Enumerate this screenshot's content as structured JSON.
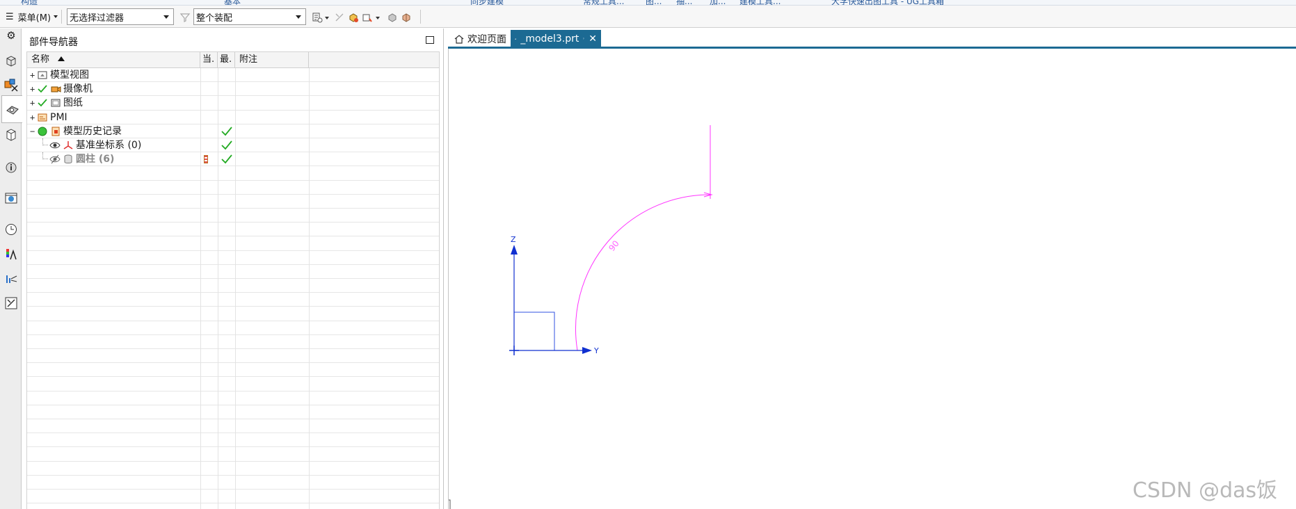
{
  "ribbon": {
    "labels": [
      "构造",
      "基本",
      "同步建模",
      "常规工具...",
      "图...",
      "抽...",
      "加...",
      "建模工具...",
      "大学快速出图工具 - UG工具箱"
    ]
  },
  "toolbar": {
    "menu_label": "菜单(M)",
    "filter_value": "无选择过滤器",
    "scope_value": "整个装配"
  },
  "navigator": {
    "title": "部件导航器",
    "columns": [
      "名称",
      "当.",
      "最.",
      "附注"
    ],
    "rows": [
      {
        "label": "模型视图",
        "expander": "+",
        "check": false,
        "up_to_date": false
      },
      {
        "label": "摄像机",
        "expander": "+",
        "check": true,
        "up_to_date": false
      },
      {
        "label": "图纸",
        "expander": "+",
        "check": true,
        "up_to_date": false
      },
      {
        "label": "PMI",
        "expander": "+",
        "check": false,
        "up_to_date": false
      },
      {
        "label": "模型历史记录",
        "expander": "−",
        "check": false,
        "up_to_date": true
      },
      {
        "label": "基准坐标系 (0)",
        "expander": "",
        "check": false,
        "up_to_date": true
      },
      {
        "label": "圆柱 (6)",
        "expander": "",
        "check": false,
        "up_to_date": true
      }
    ]
  },
  "tabs": [
    {
      "label": "欢迎页面",
      "active": false
    },
    {
      "label": "_model3.prt",
      "active": true
    }
  ],
  "viewport": {
    "dimension_text": "90",
    "axis_z": "Z",
    "axis_y": "Y",
    "axis_z2": "Z"
  },
  "watermark": "CSDN @das饭",
  "colors": {
    "accent": "#1c6a93",
    "sketch": "#ff33ff",
    "axis": "#1030d0",
    "check": "#22aa22"
  },
  "icons": {
    "rail": [
      "gear-icon",
      "assembly-navigator-icon",
      "constraint-navigator-icon",
      "part-navigator-icon",
      "reuse-library-icon",
      "hd3d-tools-icon",
      "web-browser-icon",
      "history-icon",
      "visualization-icon",
      "system-scene-icon",
      "roles-icon"
    ]
  }
}
